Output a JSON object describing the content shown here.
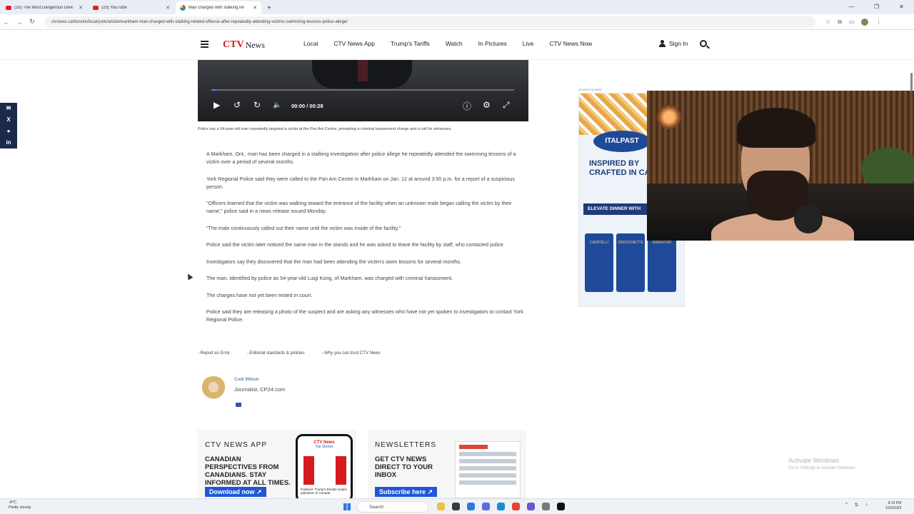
{
  "browser": {
    "tabs": [
      {
        "label": "(25) The Most Dangerous Dive",
        "active": false,
        "icon": "youtube-icon"
      },
      {
        "label": "(25) YouTube",
        "active": false,
        "icon": "youtube-icon"
      },
      {
        "label": "Man charged with stalking rel",
        "active": true,
        "icon": "ctv-icon"
      }
    ],
    "new_tab": "+",
    "url": "ctvnews.ca/toronto/local/york/article/markham-man-charged-with-stalking-related-offence-after-repeatedly-attending-victims-swimming-lessons-police-allege/"
  },
  "site": {
    "logo_brand": "CTV",
    "logo_news": "News",
    "nav": [
      "Local",
      "CTV News App",
      "Trump's Tariffs",
      "Watch",
      "In Pictures",
      "Live",
      "CTV News Now"
    ],
    "sign_in": "Sign In"
  },
  "video": {
    "time": "00:00 / 00:28",
    "progress": 0.02,
    "caption": "Police say a 54-year-old man repeatedly targeted a victim at the Pan Am Centre, prompting a criminal harassment charge and a call for witnesses."
  },
  "article": {
    "paragraphs": [
      "A Markham, Ont., man has been charged in a stalking investigation after police allege he repeatedly attended the swimming lessons of a victim over a period of several months.",
      "York Regional Police said they were called to the Pan Am Centre in Markham on Jan. 12 at around 3:50 p.m. for a report of a suspicious person.",
      "\"Officers learned that the victim was walking toward the entrance of the facility when an unknown male began calling the victim by their name,\" police said in a news release issued Monday.",
      "\"The male continuously called out their name until the victim was inside of the facility.\"",
      "Police said the victim later noticed the same man in the stands and he was asked to leave the facility by staff, who contacted police.",
      "Investigators say they discovered that the man had been attending the victim's swim lessons for several months.",
      "The man, identified by police as 54-year-old Luigi Kong, of Markham, was charged with criminal harassment.",
      "The charges have not yet been tested in court.",
      "Police said they are releasing a photo of the suspect and are asking any witnesses who have not yet spoken to investigators to contact York Regional Police."
    ],
    "footer_links": [
      "Report an Error",
      "Editorial standards & policies",
      "Why you can trust CTV News"
    ]
  },
  "author": {
    "name": "Codi Wilson",
    "role": "Journalist, CP24.com"
  },
  "promos": [
    {
      "title": "CTV NEWS APP",
      "body": "CANADIAN PERSPECTIVES FROM CANADIANS. STAY INFORMED AT ALL TIMES.",
      "button": "Download now ↗",
      "phone_brand": "CTV News",
      "phone_tab": "Top Stories",
      "phone_caption": "Poilievre: Trump's threats inspire patriotism in Canada"
    },
    {
      "title": "NEWSLETTERS",
      "body": "GET CTV NEWS DIRECT TO YOUR INBOX",
      "button": "Subscribe here ↗"
    }
  ],
  "ad": {
    "label": "ADVERTISEMENT",
    "brand": "ITALPAST",
    "headline_1": "INSPIRED BY",
    "headline_2": "CRAFTED IN CA",
    "cta": "ELEVATE DINNER WITH",
    "products": [
      "CAVATELLI",
      "ORECCHIETTE",
      "RADIATORI"
    ]
  },
  "watermark": {
    "line1": "Activate Windows",
    "line2": "Go to Settings to activate Windows."
  },
  "taskbar": {
    "weather_temp": "-8°C",
    "weather_desc": "Partly cloudy",
    "search": "Search",
    "time": "8:19 PM",
    "date": "1/20/2025"
  },
  "colors": {
    "ctv_red": "#d71920",
    "link_blue": "#3355aa",
    "cta_blue": "#1f58d6",
    "share_rail": "#1b2a4a"
  }
}
